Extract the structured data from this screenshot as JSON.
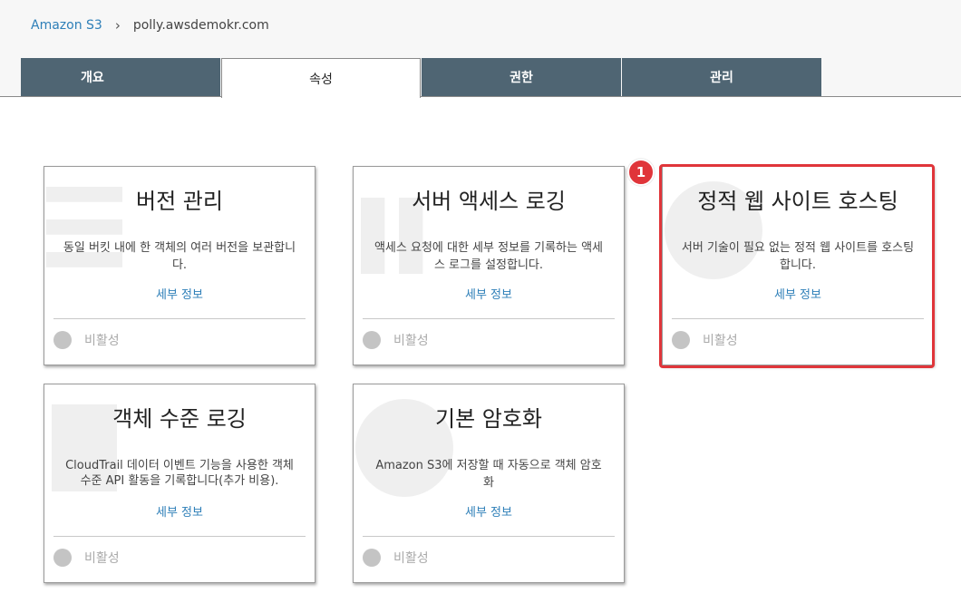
{
  "breadcrumb": {
    "root": "Amazon S3",
    "separator": "›",
    "current": "polly.awsdemokr.com"
  },
  "tabs": [
    {
      "label": "개요"
    },
    {
      "label": "속성"
    },
    {
      "label": "권한"
    },
    {
      "label": "관리"
    }
  ],
  "active_tab": "속성",
  "cards": [
    {
      "title": "버전 관리",
      "desc": "동일 버킷 내에 한 객체의 여러 버전을 보관합니다.",
      "link": "세부 정보",
      "status": "비활성",
      "icon": "versioning-watermark-icon"
    },
    {
      "title": "서버 액세스 로깅",
      "desc": "액세스 요청에 대한 세부 정보를 기록하는 액세스 로그를 설정합니다.",
      "link": "세부 정보",
      "status": "비활성",
      "icon": "logging-watermark-icon"
    },
    {
      "title": "정적 웹 사이트 호스팅",
      "desc": "서버 기술이 필요 없는 정적 웹 사이트를 호스팅합니다.",
      "link": "세부 정보",
      "status": "비활성",
      "icon": "globe-watermark-icon"
    },
    {
      "title": "객체 수준 로깅",
      "desc": "CloudTrail 데이터 이벤트 기능을 사용한 객체 수준 API 활동을 기록합니다(추가 비용).",
      "link": "세부 정보",
      "status": "비활성",
      "icon": "trail-watermark-icon"
    },
    {
      "title": "기본 암호화",
      "desc": "Amazon S3에 저장할 때 자동으로 객체 암호화",
      "link": "세부 정보",
      "status": "비활성",
      "icon": "globe-watermark-icon"
    }
  ],
  "annotation": {
    "badge_number": "1"
  },
  "colors": {
    "tab_background": "#4f6573",
    "link": "#2e7fb8",
    "highlight": "#e0353a",
    "status_dot": "#c4c4c4"
  }
}
